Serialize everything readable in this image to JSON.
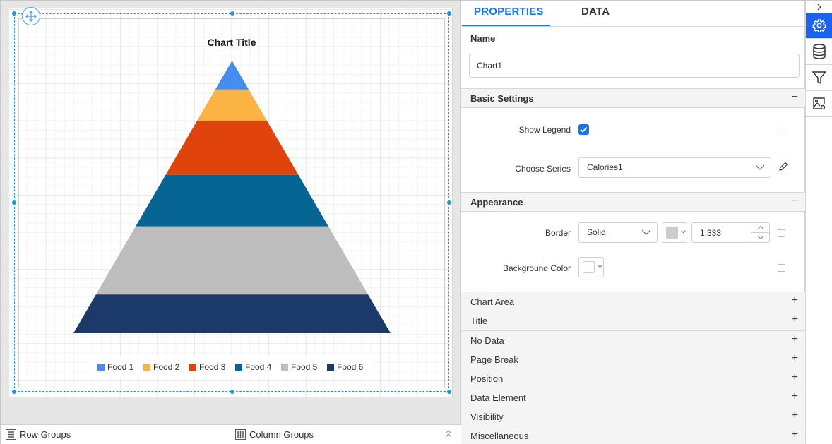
{
  "designer": {
    "chart": {
      "name": "Chart1"
    }
  },
  "chart_data": {
    "type": "pyramid",
    "title": "Chart Title",
    "categories": [
      "Food 1",
      "Food 2",
      "Food 3",
      "Food 4",
      "Food 5",
      "Food 6"
    ],
    "series": [
      {
        "name": "Calories1",
        "values": [
          10.6,
          11.4,
          19.9,
          18.9,
          25.0,
          14.2
        ],
        "colors": [
          "#448ef0",
          "#fbb443",
          "#e0440c",
          "#066592",
          "#bdbdbd",
          "#1b3a69"
        ]
      }
    ],
    "value_unit": "percent of pyramid height (estimated)",
    "legend": {
      "visible": true,
      "position": "bottom",
      "items": [
        {
          "label": "Food 1",
          "color": "#448ef0"
        },
        {
          "label": "Food 2",
          "color": "#fbb443"
        },
        {
          "label": "Food 3",
          "color": "#e0440c"
        },
        {
          "label": "Food 4",
          "color": "#066592"
        },
        {
          "label": "Food 5",
          "color": "#bdbdbd"
        },
        {
          "label": "Food 6",
          "color": "#1b3a69"
        }
      ]
    }
  },
  "groups_bar": {
    "row_groups": "Row Groups",
    "column_groups": "Column Groups"
  },
  "panel": {
    "tabs": [
      {
        "label": "PROPERTIES",
        "active": true
      },
      {
        "label": "DATA",
        "active": false
      }
    ],
    "name_label": "Name",
    "name_value": "Chart1",
    "basic_settings": {
      "title": "Basic Settings",
      "toggle": "−",
      "show_legend_label": "Show Legend",
      "show_legend_checked": true,
      "choose_series_label": "Choose Series",
      "choose_series_value": "Calories1"
    },
    "appearance": {
      "title": "Appearance",
      "toggle": "−",
      "border_label": "Border",
      "border_style": "Solid",
      "border_color": "#cccccc",
      "border_width": "1.333",
      "background_color_label": "Background Color",
      "background_color": "#ffffff"
    },
    "collapsed_sections": [
      {
        "title": "Chart Area",
        "toggle": "+"
      },
      {
        "title": "Title",
        "toggle": "+"
      },
      {
        "title": "No Data",
        "toggle": "+"
      },
      {
        "title": "Page Break",
        "toggle": "+"
      },
      {
        "title": "Position",
        "toggle": "+"
      },
      {
        "title": "Data Element",
        "toggle": "+"
      },
      {
        "title": "Visibility",
        "toggle": "+"
      },
      {
        "title": "Miscellaneous",
        "toggle": "+"
      }
    ]
  },
  "icon_bar": {
    "items": [
      {
        "icon": "gear-icon",
        "active": true
      },
      {
        "icon": "database-icon",
        "active": false
      },
      {
        "icon": "filter-icon",
        "active": false
      },
      {
        "icon": "image-settings-icon",
        "active": false
      }
    ]
  },
  "colors": {
    "accent": "#1a73e8",
    "selection": "#1f9ad6"
  }
}
